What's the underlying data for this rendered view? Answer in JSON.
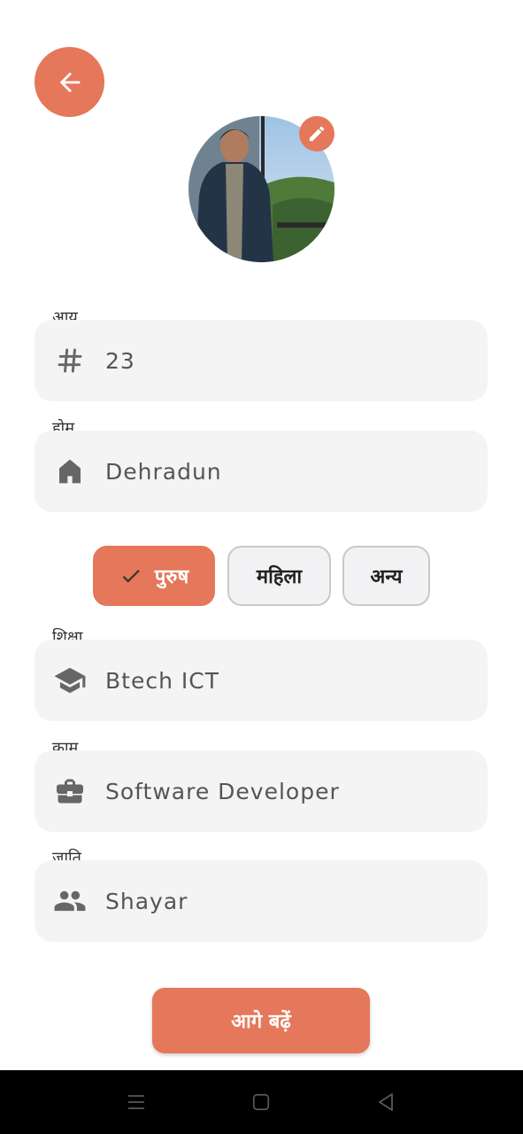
{
  "header": {
    "back_icon": "arrow-left-icon"
  },
  "profile": {
    "photo": "profile-photo",
    "edit_icon": "pencil-icon"
  },
  "fields": {
    "age": {
      "label": "आयु",
      "value": "23",
      "icon": "hash-icon"
    },
    "home": {
      "label": "होम",
      "value": "Dehradun",
      "icon": "home-icon"
    },
    "education": {
      "label": "शिक्षा",
      "value": "Btech ICT",
      "icon": "graduation-cap-icon"
    },
    "work": {
      "label": "काम",
      "value": "Software Developer",
      "icon": "briefcase-icon"
    },
    "caste": {
      "label": "जाति",
      "value": "Shayar",
      "icon": "people-icon"
    }
  },
  "gender": {
    "options": [
      "पुरुष",
      "महिला",
      "अन्य"
    ],
    "selected": "पुरुष"
  },
  "actions": {
    "next_label": "आगे बढ़ें"
  },
  "colors": {
    "accent": "#e5775a",
    "field_bg": "#f4f4f4"
  }
}
